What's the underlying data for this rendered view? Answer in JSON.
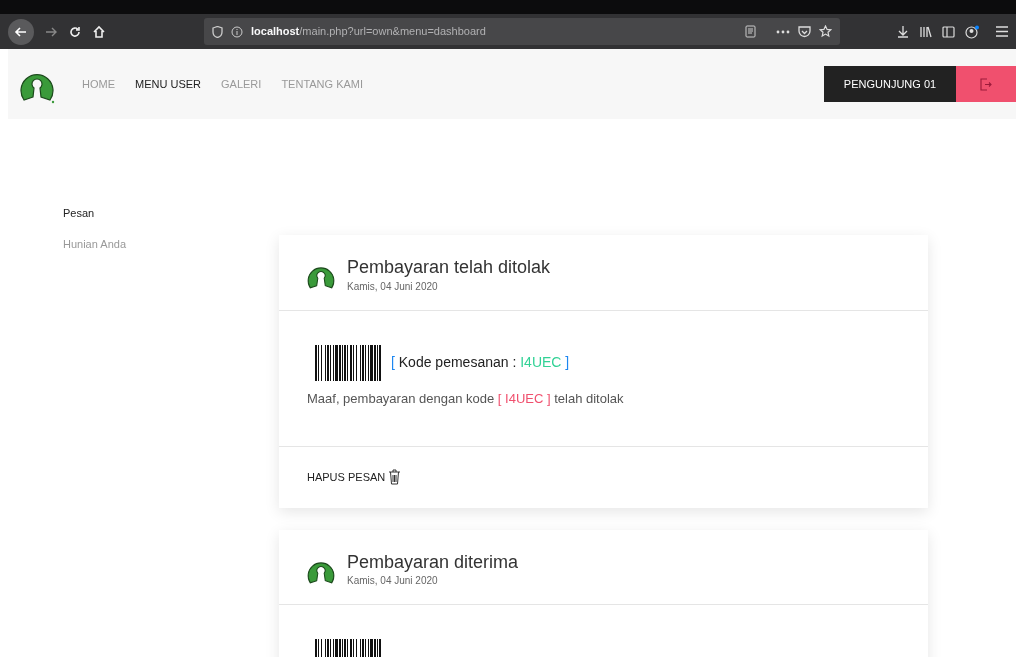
{
  "browser": {
    "url_host": "localhost",
    "url_path": "/main.php?url=own&menu=dashboard"
  },
  "navbar": {
    "items": [
      {
        "label": "HOME",
        "selected": false
      },
      {
        "label": "MENU USER",
        "selected": true
      },
      {
        "label": "GALERI",
        "selected": false
      },
      {
        "label": "TENTANG KAMI",
        "selected": false
      }
    ],
    "user": "PENGUNJUNG 01"
  },
  "sidebar": {
    "items": [
      {
        "label": "Pesan",
        "selected": true
      },
      {
        "label": "Hunian Anda",
        "selected": false
      }
    ]
  },
  "messages": [
    {
      "title": "Pembayaran telah ditolak",
      "date": "Kamis, 04 Juni 2020",
      "code_open": "[ Kode pemesanan : ",
      "code": "I4UEC",
      "code_close": " ]",
      "text_before": "Maaf, pembayaran dengan kode [ ",
      "text_code": "I4UEC",
      "text_after": " ] telah ditolak",
      "delete_label": "HAPUS PESAN"
    },
    {
      "title": "Pembayaran diterima",
      "date": "Kamis, 04 Juni 2020"
    }
  ]
}
